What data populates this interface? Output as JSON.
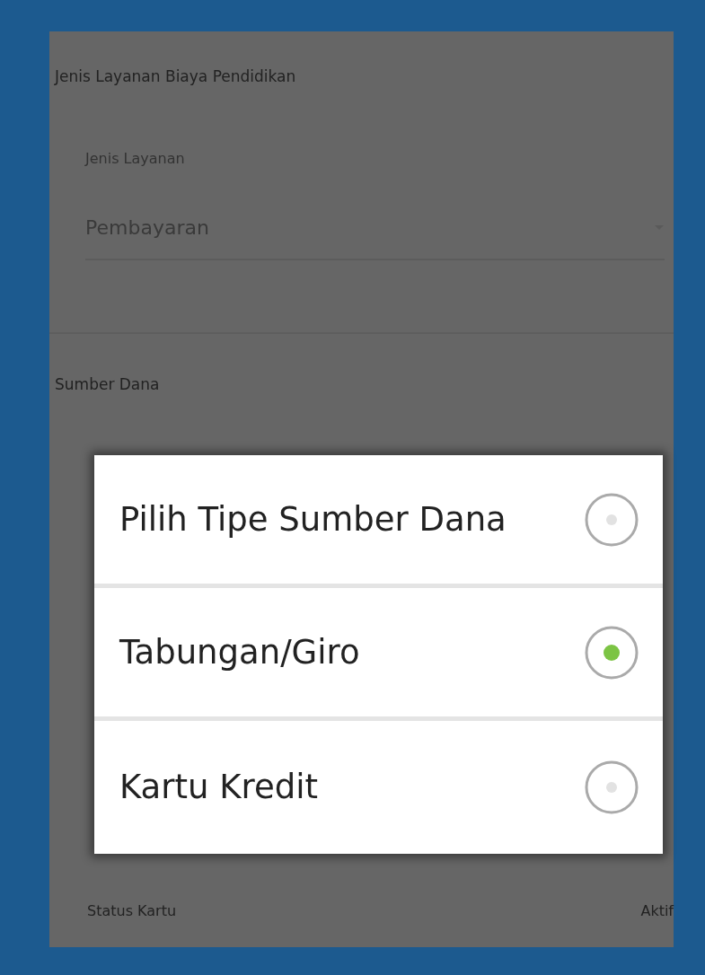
{
  "form": {
    "section_title": "Jenis Layanan Biaya Pendidikan",
    "field": {
      "label": "Jenis Layanan",
      "value": "Pembayaran"
    },
    "source_title": "Sumber Dana",
    "status": {
      "label": "Status Kartu",
      "value": "Aktif"
    }
  },
  "dialog": {
    "options": [
      {
        "label": "Pilih Tipe Sumber Dana",
        "selected": false
      },
      {
        "label": "Tabungan/Giro",
        "selected": true
      },
      {
        "label": "Kartu Kredit",
        "selected": false
      }
    ]
  }
}
